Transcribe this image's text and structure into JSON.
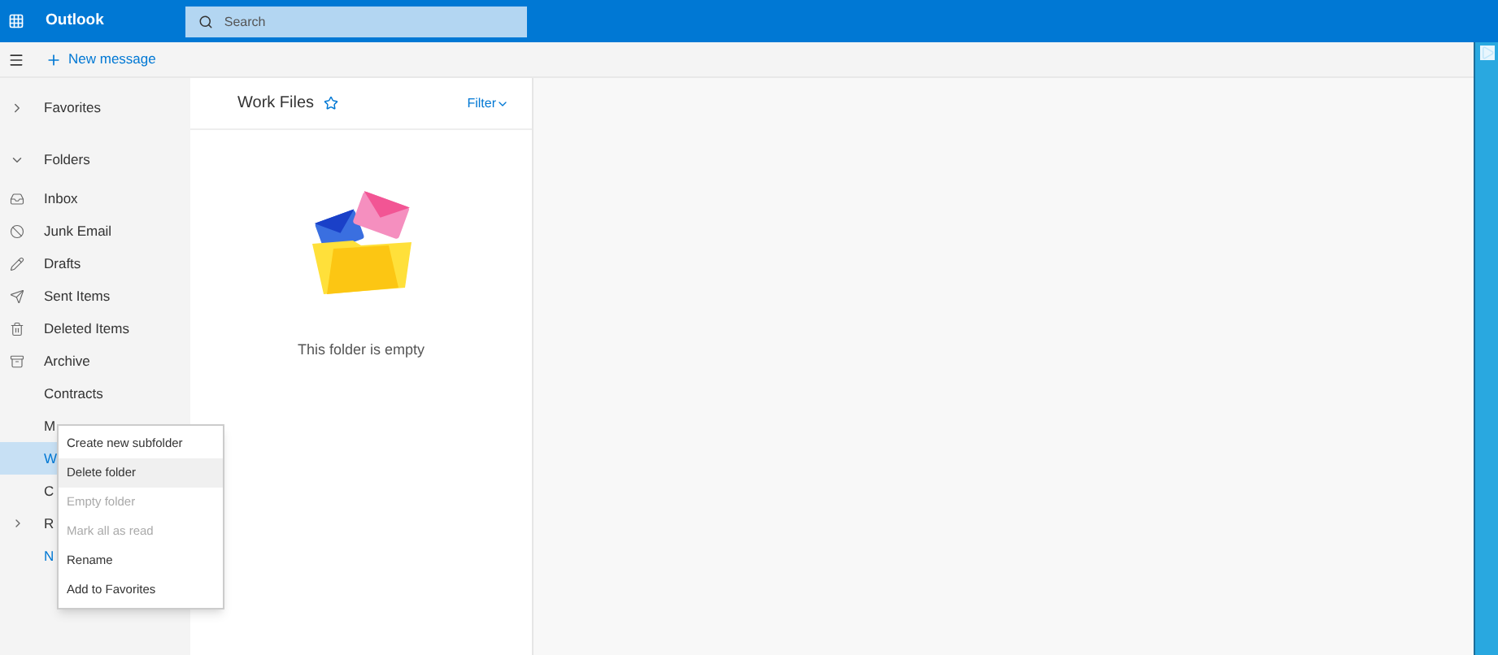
{
  "app_bar": {
    "title": "Outlook",
    "search": {
      "placeholder": "Search"
    }
  },
  "toolbar": {
    "new_message": "New message"
  },
  "sidebar": {
    "sections": [
      {
        "label": "Favorites",
        "expanded": false
      },
      {
        "label": "Folders",
        "expanded": true,
        "children": [
          {
            "label": "Inbox",
            "selected": false
          },
          {
            "label": "Junk Email",
            "selected": false
          },
          {
            "label": "Drafts",
            "selected": false
          },
          {
            "label": "Sent Items",
            "selected": false
          },
          {
            "label": "Deleted Items",
            "selected": false
          },
          {
            "label": "Archive",
            "selected": false
          },
          {
            "label": "Contracts",
            "selected": false
          },
          {
            "label": "M",
            "selected": false
          },
          {
            "label": "W",
            "selected": true
          },
          {
            "label": "C",
            "selected": false
          },
          {
            "label": "R",
            "selected": false,
            "expandable": true
          },
          {
            "label": "N",
            "kind": "link",
            "selected": false
          }
        ]
      }
    ]
  },
  "message_list": {
    "title": "Work Files",
    "filter": "Filter",
    "empty_text": "This folder is empty"
  },
  "context_menu": [
    {
      "label": "Create new subfolder",
      "disabled": false,
      "selected": false
    },
    {
      "label": "Delete folder",
      "disabled": false,
      "selected": true
    },
    {
      "label": "Empty folder",
      "disabled": true,
      "selected": false
    },
    {
      "label": "Mark all as read",
      "disabled": true,
      "selected": false
    },
    {
      "label": "Rename",
      "disabled": false,
      "selected": false
    },
    {
      "label": "Add to Favorites",
      "disabled": false,
      "selected": false
    }
  ]
}
